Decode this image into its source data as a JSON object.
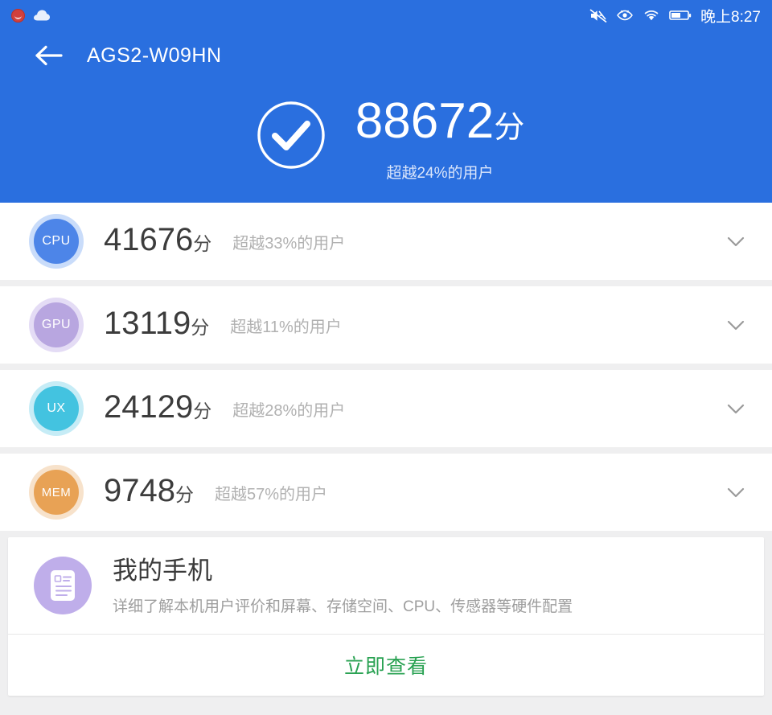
{
  "statusbar": {
    "time": "晚上8:27",
    "icons_left": [
      "alarm-red-icon",
      "cloud-icon"
    ],
    "icons_right": [
      "mute-icon",
      "eye-comfort-icon",
      "wifi-icon",
      "battery-icon"
    ]
  },
  "navbar": {
    "back_icon": "back-arrow-icon",
    "title": "AGS2-W09HN"
  },
  "summary": {
    "check_icon": "check-circle-icon",
    "score": "88672",
    "score_unit": "分",
    "subtitle": "超越24%的用户",
    "header_color": "#2a6fdf"
  },
  "metrics": [
    {
      "key": "cpu",
      "badge": "CPU",
      "score": "41676",
      "unit": "分",
      "subtitle": "超越33%的用户",
      "color": "#4d85e8",
      "ring": "#c9dcfa",
      "chevron": "chevron-down-icon"
    },
    {
      "key": "gpu",
      "badge": "GPU",
      "score": "13119",
      "unit": "分",
      "subtitle": "超越11%的用户",
      "color": "#b8a6e0",
      "ring": "#e4dcf5",
      "chevron": "chevron-down-icon"
    },
    {
      "key": "ux",
      "badge": "UX",
      "score": "24129",
      "unit": "分",
      "subtitle": "超越28%的用户",
      "color": "#43c3e0",
      "ring": "#c6ecf6",
      "chevron": "chevron-down-icon"
    },
    {
      "key": "mem",
      "badge": "MEM",
      "score": "9748",
      "unit": "分",
      "subtitle": "超越57%的用户",
      "color": "#e8a255",
      "ring": "#f7e2cb",
      "chevron": "chevron-down-icon"
    }
  ],
  "phone_card": {
    "icon": "document-list-icon",
    "icon_bg": "#bfaeea",
    "title": "我的手机",
    "description": "详细了解本机用户评价和屏幕、存储空间、CPU、传感器等硬件配置",
    "action_label": "立即查看",
    "action_color": "#2aa253"
  }
}
